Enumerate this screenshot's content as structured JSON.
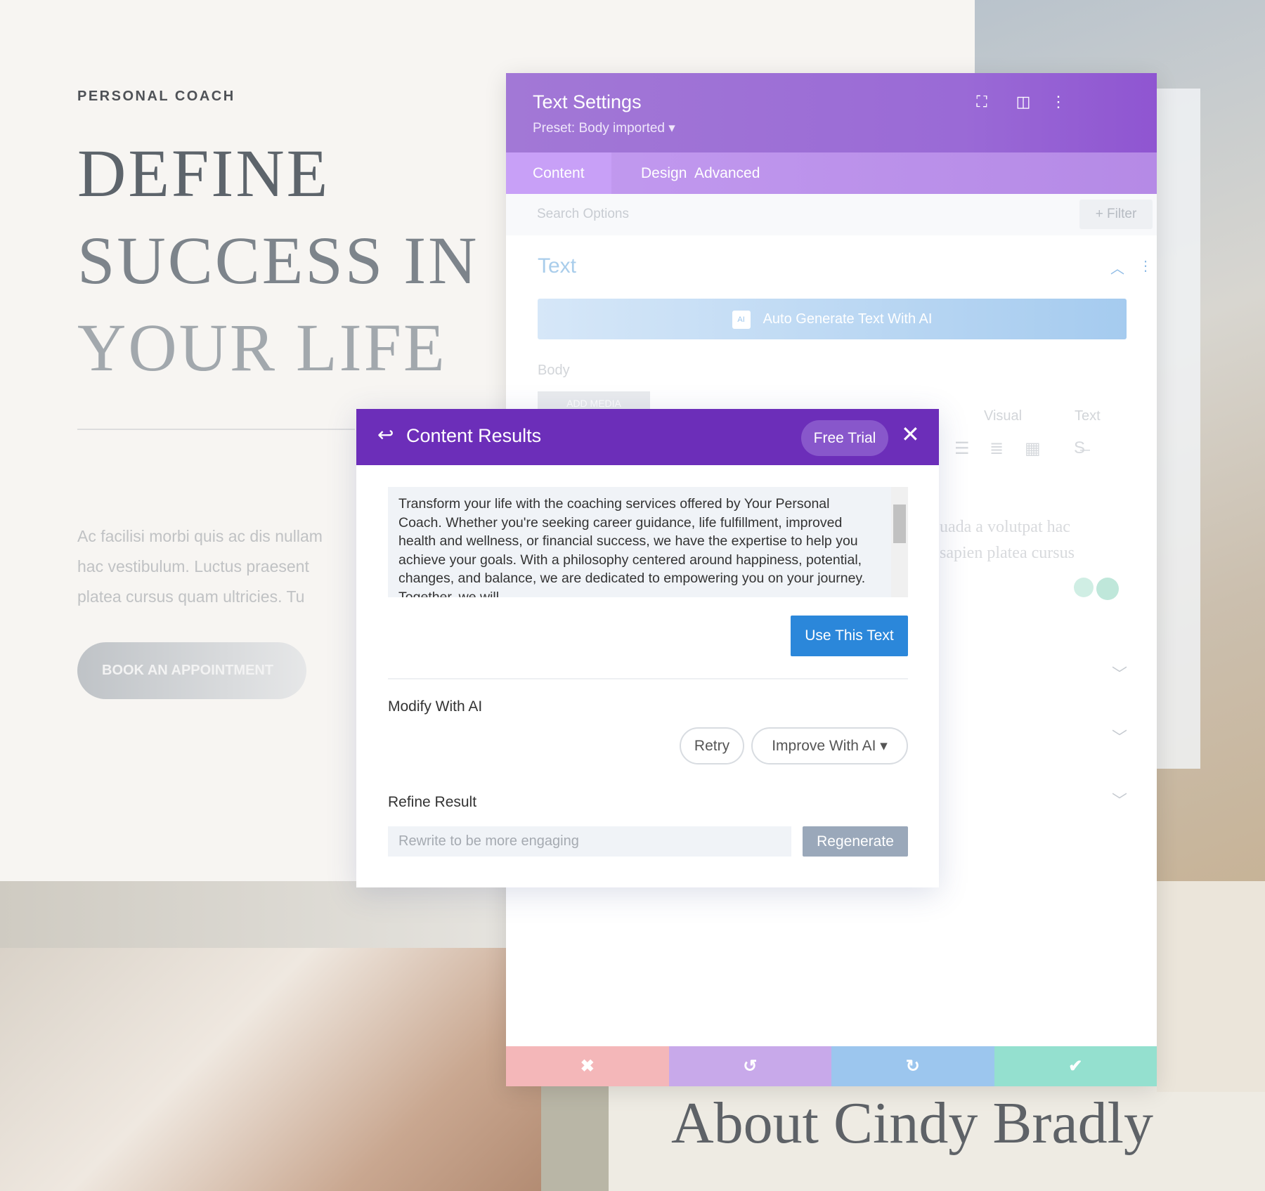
{
  "page": {
    "kicker": "PERSONAL COACH",
    "headline": [
      "DEFINE",
      "SUCCESS IN",
      "YOUR LIFE"
    ],
    "paragraph": [
      "Ac facilisi morbi quis ac dis nullam",
      "hac vestibulum. Luctus praesent",
      "platea cursus quam ultricies. Tu"
    ],
    "cta": "BOOK AN APPOINTMENT",
    "about_heading": "About Cindy Bradly"
  },
  "settings": {
    "title": "Text Settings",
    "preset": "Preset: Body imported ▾",
    "icons": [
      "fullscreen-icon",
      "split-view-icon",
      "more-icon"
    ],
    "tabs": [
      {
        "label": "Content",
        "active": true
      },
      {
        "label": "Design"
      },
      {
        "label": "Advanced"
      }
    ],
    "search_placeholder": "Search Options",
    "filter_label": "+ Filter",
    "section_title": "Text",
    "ai_button": "Auto Generate Text With AI",
    "ai_badge": "AI",
    "body_label": "Body",
    "add_media": "ADD MEDIA",
    "editor_tabs": [
      "Visual",
      "Text"
    ],
    "faint_text": [
      "uada a volutpat hac",
      "sapien platea cursus"
    ],
    "footer": {
      "colors": [
        "#f4b7b9",
        "#c8a9ea",
        "#9cc6ee",
        "#94e0cf"
      ],
      "icons": [
        "close-icon",
        "undo-icon",
        "redo-icon",
        "check-icon"
      ]
    }
  },
  "modal": {
    "title": "Content Results",
    "free_trial": "Free Trial",
    "result_text": "Transform your life with the coaching services offered by Your Personal Coach. Whether you're seeking career guidance, life fulfillment, improved health and wellness, or financial success, we have the expertise to help you achieve your goals. With a philosophy centered around happiness, potential, changes, and balance, we are dedicated to empowering you on your journey. Together, we will",
    "use_button": "Use This Text",
    "modify_label": "Modify With AI",
    "retry": "Retry",
    "improve": "Improve With AI ▾",
    "refine_label": "Refine Result",
    "refine_placeholder": "Rewrite to be more engaging",
    "regenerate": "Regenerate",
    "header_color": "#6c2eb9",
    "accent": "#2b87da"
  }
}
